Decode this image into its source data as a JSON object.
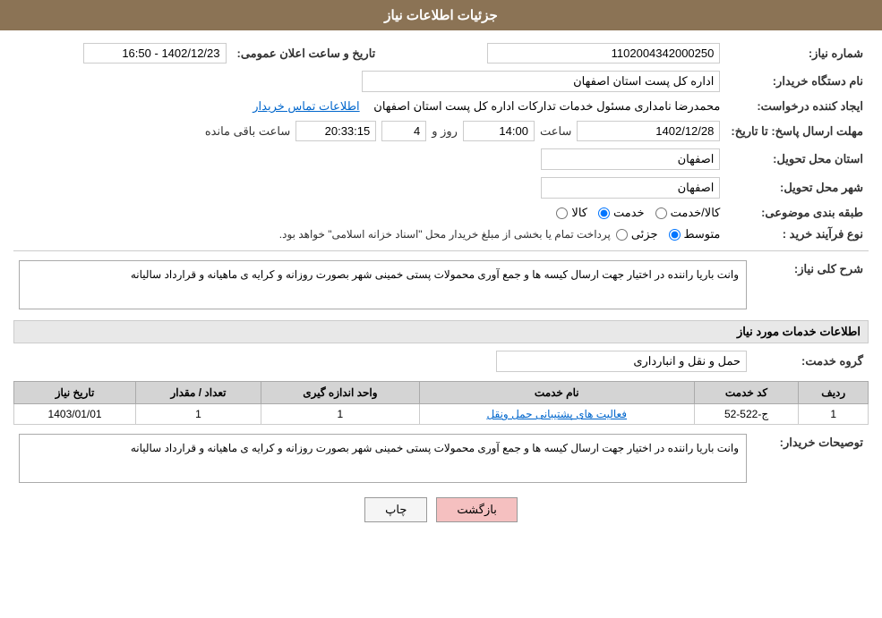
{
  "header": {
    "title": "جزئیات اطلاعات نیاز"
  },
  "fields": {
    "need_number_label": "شماره نیاز:",
    "need_number_value": "1102004342000250",
    "buyer_org_label": "نام دستگاه خریدار:",
    "buyer_org_value": "اداره کل پست استان اصفهان",
    "announce_date_label": "تاریخ و ساعت اعلان عمومی:",
    "announce_date_value": "1402/12/23 - 16:50",
    "creator_label": "ایجاد کننده درخواست:",
    "creator_value": "محمدرضا نامداری مسئول خدمات تداركات اداره كل پست استان اصفهان",
    "contact_link": "اطلاعات تماس خریدار",
    "deadline_label": "مهلت ارسال پاسخ: تا تاریخ:",
    "deadline_date": "1402/12/28",
    "deadline_time_label": "ساعت",
    "deadline_time": "14:00",
    "deadline_days_label": "روز و",
    "deadline_days": "4",
    "deadline_remaining_label": "ساعت باقی مانده",
    "deadline_remaining": "20:33:15",
    "province_delivery_label": "استان محل تحویل:",
    "province_delivery_value": "اصفهان",
    "city_delivery_label": "شهر محل تحویل:",
    "city_delivery_value": "اصفهان",
    "category_label": "طبقه بندی موضوعی:",
    "category_options": [
      "کالا",
      "خدمت",
      "کالا/خدمت"
    ],
    "category_selected": "خدمت",
    "purchase_type_label": "نوع فرآیند خرید :",
    "purchase_type_options": [
      "جزئی",
      "متوسط"
    ],
    "purchase_type_note": "پرداخت تمام یا بخشی از مبلغ خریدار محل \"اسناد خزانه اسلامی\" خواهد بود.",
    "general_desc_label": "شرح کلی نیاز:",
    "general_desc_value": "وانت باریا راننده در اختیار جهت ارسال کیسه ها و جمع آوری محمولات پستی  خمینی شهر بصورت روزانه و کرایه ی ماهیانه و قرارداد سالیانه",
    "services_section_label": "اطلاعات خدمات مورد نیاز",
    "service_group_label": "گروه خدمت:",
    "service_group_value": "حمل و نقل و انبارداری",
    "table": {
      "headers": [
        "ردیف",
        "کد خدمت",
        "نام خدمت",
        "واحد اندازه گیری",
        "تعداد / مقدار",
        "تاریخ نیاز"
      ],
      "rows": [
        {
          "row": "1",
          "code": "ج-522-52",
          "name": "فعالیت های پشتیبانی حمل ونقل",
          "unit": "1",
          "quantity": "1",
          "date": "1403/01/01"
        }
      ]
    },
    "buyer_desc_label": "توصیحات خریدار:",
    "buyer_desc_value": "وانت باریا راننده در اختیار جهت ارسال کیسه ها و جمع آوری محمولات پستی  خمینی شهر بصورت روزانه و کرایه ی ماهیانه و قرارداد سالیانه"
  },
  "buttons": {
    "print_label": "چاپ",
    "back_label": "بازگشت"
  }
}
